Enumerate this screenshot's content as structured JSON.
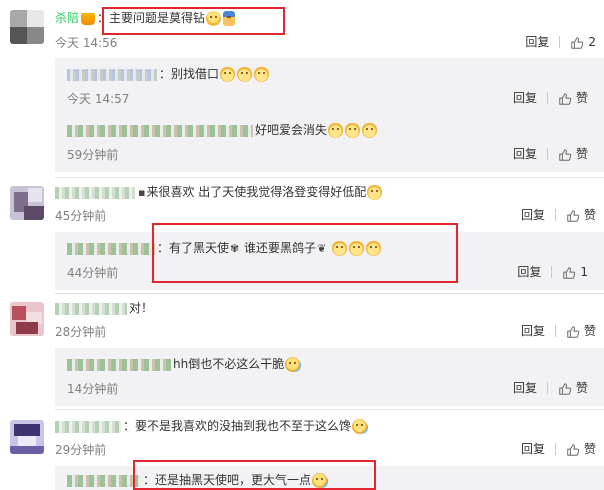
{
  "comments": [
    {
      "username": "杀陪",
      "text": "：主要问题是莫得钻",
      "time": "今天 14:56",
      "reply_label": "回复",
      "like_count": "2",
      "replies": [
        {
          "text": "：别找借口",
          "time": "今天 14:57",
          "reply_label": "回复",
          "like_label": "赞"
        },
        {
          "text": "好吧爱会消失",
          "time": "59分钟前",
          "reply_label": "回复",
          "like_label": "赞"
        }
      ]
    },
    {
      "text_a": "来很喜欢 出了天使我觉得洛登变得好低配",
      "time": "45分钟前",
      "reply_label": "回复",
      "like_label": "赞",
      "replies": [
        {
          "text_a": "：有了黑天使",
          "text_b": " 谁还要黑鸽子",
          "time": "44分钟前",
          "reply_label": "回复",
          "like_count": "1"
        }
      ]
    },
    {
      "text": "对！",
      "time": "28分钟前",
      "reply_label": "回复",
      "like_label": "赞",
      "replies": [
        {
          "text": "hh倒也不必这么干脆",
          "time": "14分钟前",
          "reply_label": "回复",
          "like_label": "赞"
        }
      ]
    },
    {
      "text": "：要不是我喜欢的没抽到我也不至于这么馋",
      "time": "29分钟前",
      "reply_label": "回复",
      "like_label": "赞",
      "replies": [
        {
          "text": "：还是抽黑天使吧，更大气一点"
        }
      ]
    }
  ],
  "icons": {
    "like": "thumbs-up-icon",
    "emoji_laugh": "laughing-face-emoji",
    "emoji_cat": "cat-face-emoji",
    "emoji_sweat": "sweat-smile-emoji"
  },
  "colors": {
    "highlight": "#e0272f",
    "username": "#33cc66",
    "reply_bg": "#f2f2f5",
    "muted": "#808080"
  }
}
